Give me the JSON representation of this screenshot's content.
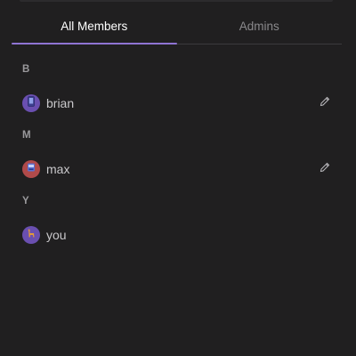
{
  "tabs": [
    {
      "label": "All Members",
      "active": true
    },
    {
      "label": "Admins",
      "active": false
    }
  ],
  "sections": [
    {
      "letter": "B",
      "members": [
        {
          "name": "brian",
          "avatar_color": "#6a4fb0",
          "avatar_icon": "phone-icon",
          "editable": true
        }
      ]
    },
    {
      "letter": "M",
      "members": [
        {
          "name": "max",
          "avatar_color": "#b04a4a",
          "avatar_icon": "robot-icon",
          "editable": true
        }
      ]
    },
    {
      "letter": "Y",
      "members": [
        {
          "name": "you",
          "avatar_color": "#6a4fb0",
          "avatar_icon": "llama-icon",
          "editable": false
        }
      ]
    }
  ],
  "colors": {
    "background": "#201f20",
    "accent": "#8f74d3",
    "text_primary": "#ffffff",
    "text_secondary": "#8a898c"
  }
}
